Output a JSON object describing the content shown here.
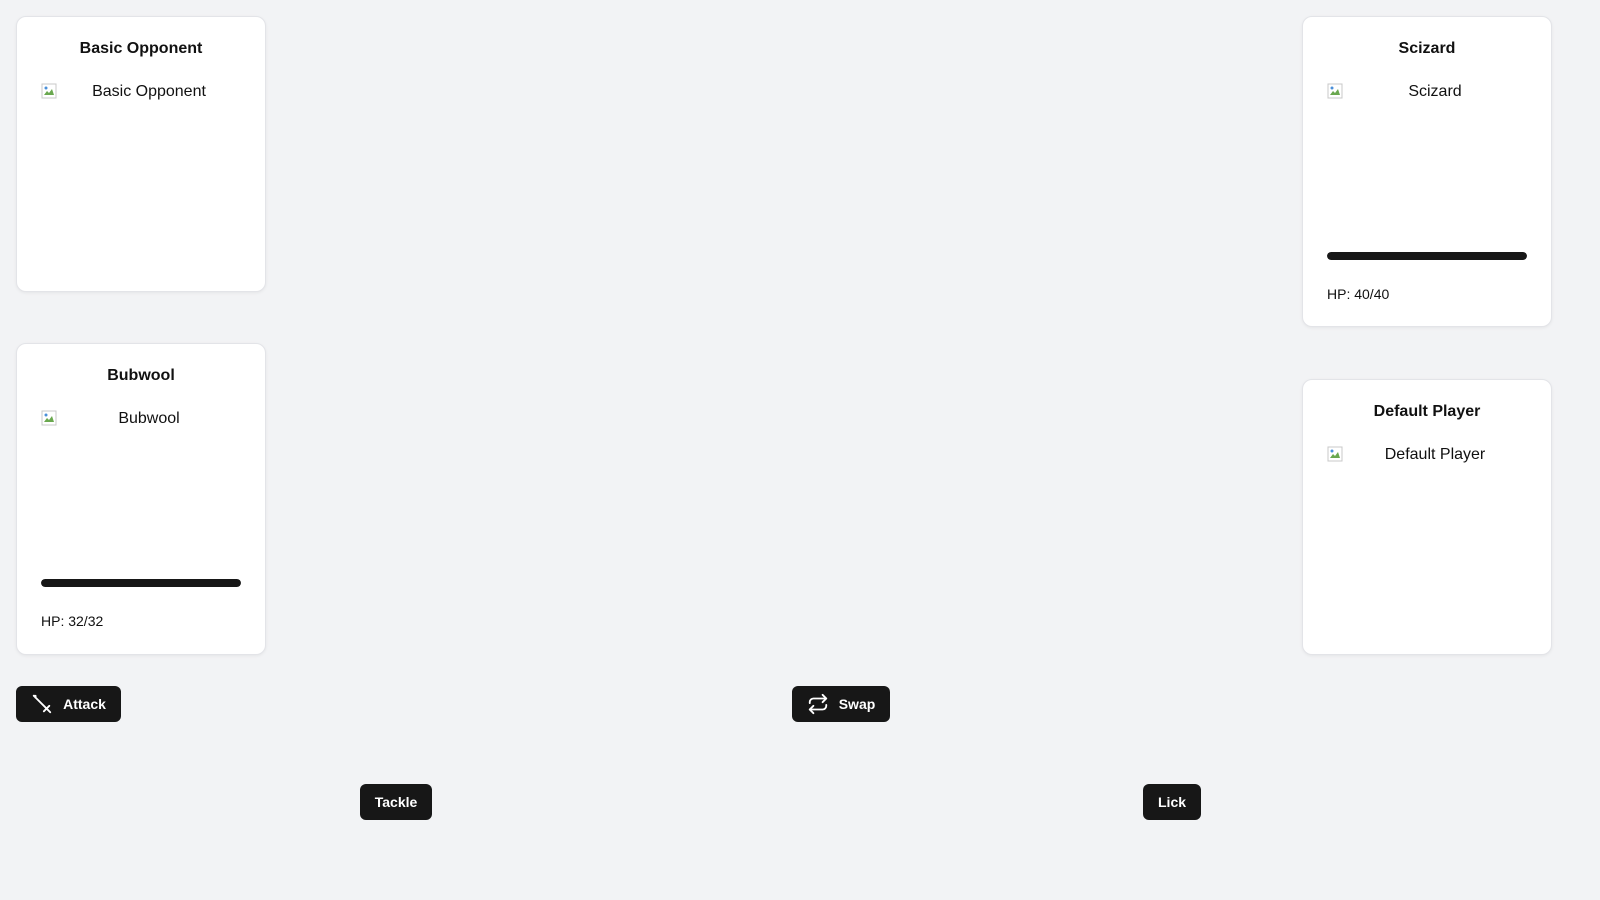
{
  "opponent_side": {
    "trainer": {
      "name": "Basic Opponent",
      "image_alt": "Basic Opponent"
    },
    "monster": {
      "name": "Bubwool",
      "image_alt": "Bubwool",
      "hp_text": "HP: 32/32",
      "hp_fraction": 1.0
    }
  },
  "player_side": {
    "monster": {
      "name": "Scizard",
      "image_alt": "Scizard",
      "hp_text": "HP: 40/40",
      "hp_fraction": 1.0
    },
    "trainer": {
      "name": "Default Player",
      "image_alt": "Default Player"
    }
  },
  "actions": {
    "attack_label": "Attack",
    "swap_label": "Swap",
    "attack_icon": "sword-icon",
    "swap_icon": "swap-arrows-icon"
  },
  "moves": [
    {
      "label": "Tackle"
    },
    {
      "label": "Lick"
    }
  ],
  "colors": {
    "background": "#f2f3f5",
    "card": "#ffffff",
    "button": "#171717",
    "hp_fill": "#171717"
  }
}
